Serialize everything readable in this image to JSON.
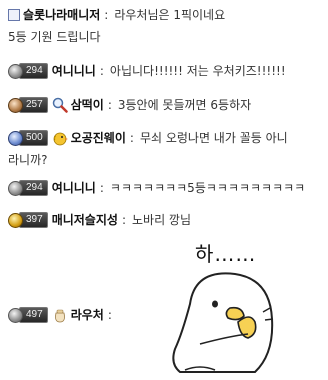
{
  "messages": [
    {
      "name": "슬롯나라매니저",
      "text": "라우처님은 1픽이네요",
      "continuation": "5등 기원 드립니다",
      "icon": "admin-icon"
    },
    {
      "name": "여니니니",
      "level": "294",
      "text": "아닙니다!!!!!! 저는 우처키즈!!!!!!",
      "badge_color": "silver"
    },
    {
      "name": "삼떡이",
      "level": "257",
      "text": "3등안에 못들꺼면 6등하자",
      "badge_color": "bronze",
      "icon": "magnifier-icon"
    },
    {
      "name": "오공진웨이",
      "level": "500",
      "text": "무쇠 오렁나면 내가 꼴등 아니",
      "continuation": "라니까?",
      "badge_color": "blue",
      "icon": "bird-icon"
    },
    {
      "name": "여니니니",
      "level": "294",
      "text": "ㅋㅋㅋㅋㅋㅋㅋ5등ㅋㅋㅋㅋㅋㅋㅋㅋㅋ",
      "badge_color": "silver"
    },
    {
      "name": "매니저슬지성",
      "level": "397",
      "text": "노바리 깡님",
      "badge_color": "gold"
    },
    {
      "name": "라우처",
      "level": "497",
      "text": "",
      "badge_color": "silver",
      "icon": "pouch-icon"
    }
  ],
  "sticker": {
    "caption": "하……",
    "icon": "duck-sticker-icon"
  }
}
